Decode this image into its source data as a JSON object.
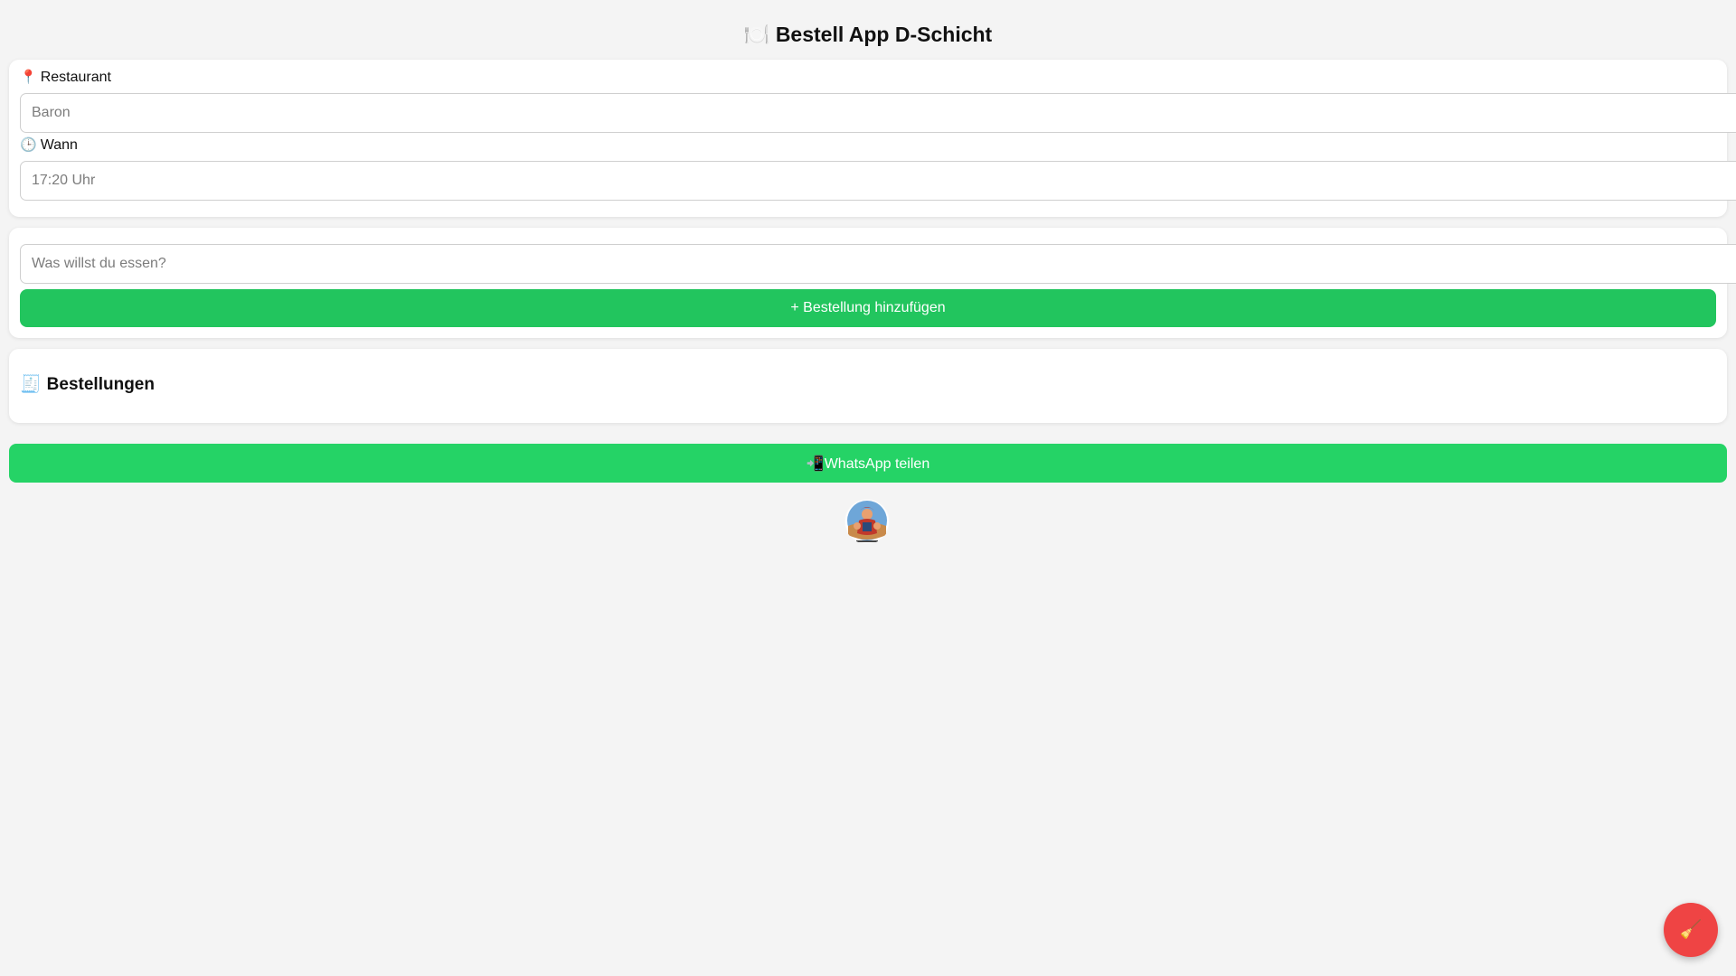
{
  "header": {
    "icon": "🍽️",
    "title": "Bestell App D-Schicht"
  },
  "details": {
    "restaurant_icon": "📍",
    "restaurant_label": "Restaurant",
    "restaurant_placeholder": "Baron",
    "time_icon": "🕒",
    "time_label": "Wann",
    "time_placeholder": "17:20 Uhr"
  },
  "order_form": {
    "food_placeholder": "Was willst du essen?",
    "add_button_label": "+ Bestellung hinzufügen"
  },
  "orders": {
    "icon": "🧾",
    "heading": "Bestellungen",
    "items": []
  },
  "share": {
    "icon": "📲",
    "label": "WhatsApp teilen"
  },
  "logo": {
    "name": "team-logo"
  },
  "clear_button": {
    "icon": "🧹"
  },
  "colors": {
    "background": "#f4f4f4",
    "card": "#ffffff",
    "add_button": "#22c55e",
    "whatsapp_button": "#25d366",
    "clear_button": "#ef4444"
  }
}
